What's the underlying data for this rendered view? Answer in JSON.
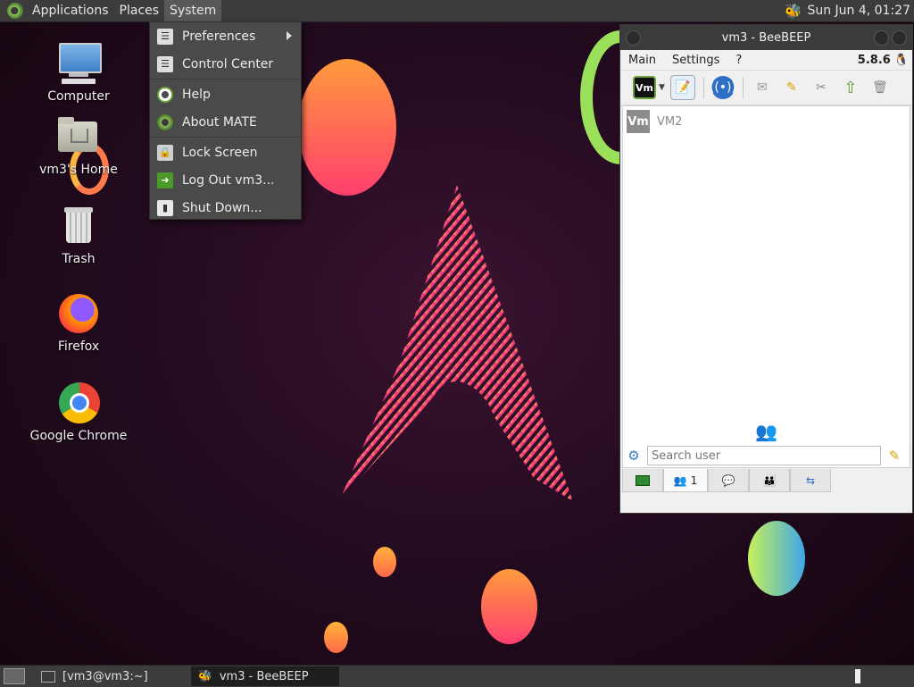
{
  "top_panel": {
    "menus": [
      "Applications",
      "Places",
      "System"
    ],
    "clock": "Sun Jun  4, 01:27"
  },
  "desktop_icons": [
    {
      "label": "Computer"
    },
    {
      "label": "vm3's Home"
    },
    {
      "label": "Trash"
    },
    {
      "label": "Firefox"
    },
    {
      "label": "Google Chrome"
    }
  ],
  "system_menu": {
    "items": [
      {
        "label": "Preferences",
        "icon": "preferences-icon"
      },
      {
        "label": "Control Center",
        "icon": "control-center-icon"
      },
      {
        "label": "Help",
        "icon": "help-icon"
      },
      {
        "label": "About MATE",
        "icon": "about-mate-icon"
      },
      {
        "label": "Lock Screen",
        "icon": "lock-screen-icon"
      },
      {
        "label": "Log Out vm3...",
        "icon": "logout-icon"
      },
      {
        "label": "Shut Down...",
        "icon": "shutdown-icon"
      }
    ]
  },
  "beebeep": {
    "title": "vm3 - BeeBEEP",
    "menu": [
      "Main",
      "Settings",
      "?"
    ],
    "version": "5.8.6",
    "users": [
      {
        "avatar": "Vm",
        "name": "VM2"
      }
    ],
    "toolbar_avatar": "Vm",
    "search_placeholder": "Search user",
    "tabs": [
      {
        "label": ""
      },
      {
        "label": "1"
      },
      {
        "label": ""
      },
      {
        "label": ""
      },
      {
        "label": ""
      }
    ]
  },
  "bottom_panel": {
    "tasks": [
      "[vm3@vm3:~]",
      "vm3 - BeeBEEP"
    ]
  },
  "colors": {
    "panel": "#3c3c3c",
    "accent_green": "#6aa33a",
    "wallpaper": "#240b20"
  }
}
